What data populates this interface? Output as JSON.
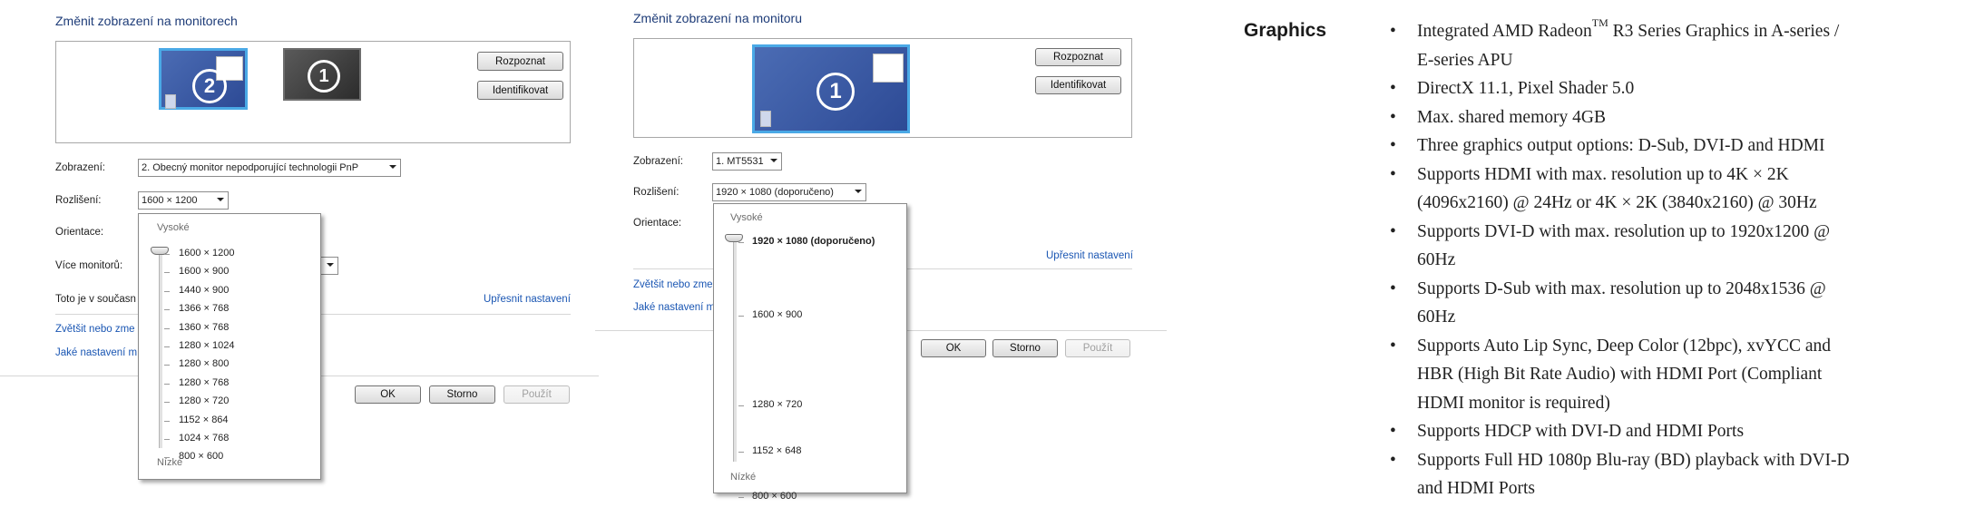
{
  "panel1": {
    "title": "Změnit zobrazení na monitorech",
    "monitor_big_number": "2",
    "monitor_small_number": "1",
    "detect_label": "Rozpoznat",
    "identify_label": "Identifikovat",
    "display_label": "Zobrazení:",
    "display_value": "2. Obecný monitor nepodporující technologii PnP",
    "resolution_label": "Rozlišení:",
    "resolution_value": "1600 × 1200",
    "orientation_label": "Orientace:",
    "multi_label": "Více monitorů:",
    "current_label": "Toto je v současn",
    "advanced_link": "Upřesnit nastavení",
    "link1": "Zvětšit nebo zme",
    "link2": "Jaké nastavení m",
    "ok_label": "OK",
    "cancel_label": "Storno",
    "apply_label": "Použít",
    "popup": {
      "high_label": "Vysoké",
      "low_label": "Nízké",
      "options": [
        "1600 × 1200",
        "1600 × 900",
        "1440 × 900",
        "1366 × 768",
        "1360 × 768",
        "1280 × 1024",
        "1280 × 800",
        "1280 × 768",
        "1280 × 720",
        "1152 × 864",
        "1024 × 768",
        "800 × 600"
      ]
    }
  },
  "panel2": {
    "title": "Změnit zobrazení na monitoru",
    "monitor_number": "1",
    "detect_label": "Rozpoznat",
    "identify_label": "Identifikovat",
    "display_label": "Zobrazení:",
    "display_value": "1. MT5531",
    "resolution_label": "Rozlišení:",
    "resolution_value": "1920 × 1080 (doporučeno)",
    "orientation_label": "Orientace:",
    "advanced_link": "Upřesnit nastavení",
    "link1": "Zvětšit nebo zme",
    "link2": "Jaké nastavení m",
    "ok_label": "OK",
    "cancel_label": "Storno",
    "apply_label": "Použít",
    "popup": {
      "high_label": "Vysoké",
      "low_label": "Nízké",
      "options": [
        "1920 × 1080 (doporučeno)",
        "1600 × 900",
        "1280 × 720",
        "1152 × 648",
        "800 × 600"
      ]
    }
  },
  "spec": {
    "heading": "Graphics",
    "item1_pre": "Integrated AMD Radeon",
    "item1_sup": "TM",
    "item1_l1_post": " R3 Series Graphics in A-series /",
    "item1_l2": "E-series APU",
    "item2": "DirectX 11.1, Pixel Shader 5.0",
    "item3": "Max. shared memory 4GB",
    "item4": "Three graphics output options: D-Sub, DVI-D and HDMI",
    "item5_l1": "Supports HDMI with max. resolution up to 4K × 2K",
    "item5_l2": "(4096x2160) @ 24Hz or 4K × 2K (3840x2160) @ 30Hz",
    "item6_l1": "Supports DVI-D with max. resolution up to 1920x1200 @",
    "item6_l2": "60Hz",
    "item7_l1": "Supports D-Sub with max. resolution up to 2048x1536 @",
    "item7_l2": "60Hz",
    "item8_l1": "Supports Auto Lip Sync, Deep Color (12bpc), xvYCC and",
    "item8_l2": "HBR (High Bit Rate Audio) with HDMI Port (Compliant",
    "item8_l3": "HDMI monitor is required)",
    "item9": "Supports HDCP with DVI-D and HDMI Ports",
    "item10_l1": "Supports Full HD 1080p Blu-ray (BD) playback with DVI-D",
    "item10_l2": "and HDMI Ports"
  }
}
